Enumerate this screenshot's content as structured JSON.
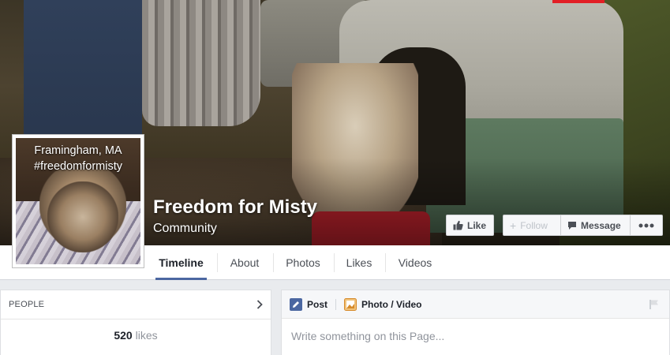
{
  "page": {
    "name": "Freedom for Misty",
    "category": "Community"
  },
  "profile": {
    "caption_line1": "Framingham, MA",
    "caption_line2": "#freedomformisty"
  },
  "actions": {
    "like": "Like",
    "follow": "Follow",
    "message": "Message",
    "more_icon": "ellipsis-icon"
  },
  "tabs": [
    {
      "label": "Timeline",
      "active": true
    },
    {
      "label": "About"
    },
    {
      "label": "Photos"
    },
    {
      "label": "Likes"
    },
    {
      "label": "Videos"
    }
  ],
  "people": {
    "title": "PEOPLE",
    "likes_count": "520",
    "likes_word": "likes"
  },
  "composer": {
    "post_label": "Post",
    "photo_label": "Photo / Video",
    "placeholder": "Write something on this Page..."
  },
  "colors": {
    "accent": "#4b67a1",
    "background": "#e9ebee"
  }
}
